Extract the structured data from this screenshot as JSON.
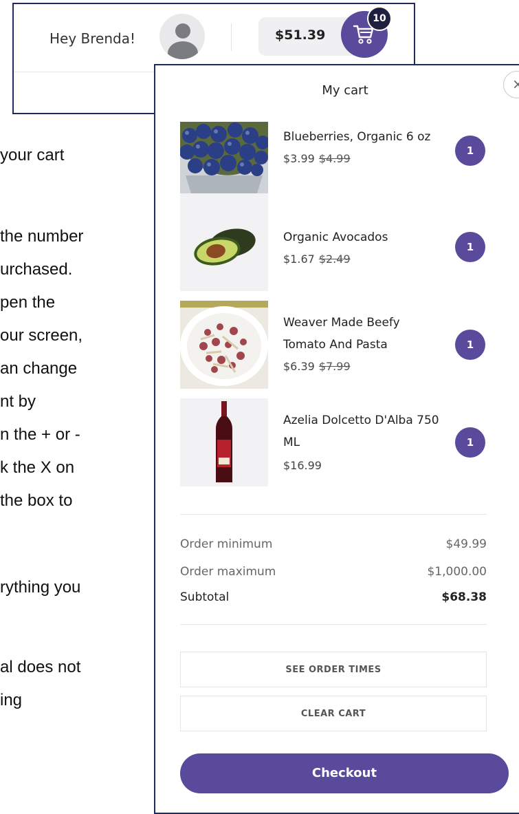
{
  "instructions": {
    "lines": [
      "your cart",
      "the",
      "number",
      "urchased.",
      "pen the",
      "our screen,",
      "an change",
      "nt by",
      "n the + or -",
      "k the X on",
      "the box to",
      "rything you",
      "al does not",
      "ing"
    ]
  },
  "header": {
    "greeting": "Hey Brenda!",
    "cart_total": "$51.39",
    "cart_count": "10"
  },
  "drawer": {
    "title": "My cart",
    "close_glyph": "×",
    "items": [
      {
        "name": "Blueberries, Organic 6 oz",
        "price": "$3.99",
        "original_price": "$4.99",
        "qty": "1",
        "icon": "blueberries-image"
      },
      {
        "name": "Organic Avocados",
        "price": "$1.67",
        "original_price": "$2.49",
        "qty": "1",
        "icon": "avocado-image"
      },
      {
        "name": "Weaver Made Beefy Tomato And Pasta",
        "price": "$6.39",
        "original_price": "$7.99",
        "qty": "1",
        "icon": "pasta-plate-image"
      },
      {
        "name": "Azelia Dolcetto D'Alba 750 ML",
        "price": "$16.99",
        "original_price": "",
        "qty": "1",
        "icon": "wine-bottle-image"
      }
    ],
    "summary": {
      "order_minimum_label": "Order minimum",
      "order_minimum_value": "$49.99",
      "order_maximum_label": "Order maximum",
      "order_maximum_value": "$1,000.00",
      "subtotal_label": "Subtotal",
      "subtotal_value": "$68.38"
    },
    "see_order_times": "SEE ORDER TIMES",
    "clear_cart": "CLEAR CART",
    "checkout": "Checkout"
  },
  "colors": {
    "accent": "#5a4a9c",
    "frame": "#1e2b5e",
    "highlight_text": "#6a3fa0"
  }
}
